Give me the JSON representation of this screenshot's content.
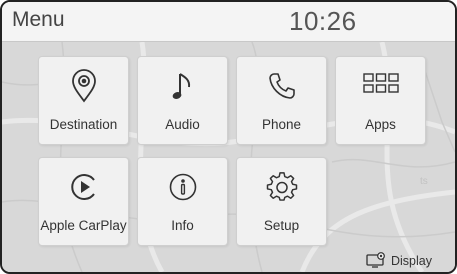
{
  "header": {
    "title": "Menu",
    "clock": "10:26"
  },
  "tiles": [
    {
      "label": "Destination",
      "icon": "location-pin-icon"
    },
    {
      "label": "Audio",
      "icon": "music-note-icon"
    },
    {
      "label": "Phone",
      "icon": "phone-icon"
    },
    {
      "label": "Apps",
      "icon": "apps-grid-icon"
    },
    {
      "label": "Apple CarPlay",
      "icon": "carplay-play-icon"
    },
    {
      "label": "Info",
      "icon": "info-icon"
    },
    {
      "label": "Setup",
      "icon": "gear-icon"
    }
  ],
  "footer": {
    "display_label": "Display",
    "display_icon": "display-settings-icon"
  }
}
